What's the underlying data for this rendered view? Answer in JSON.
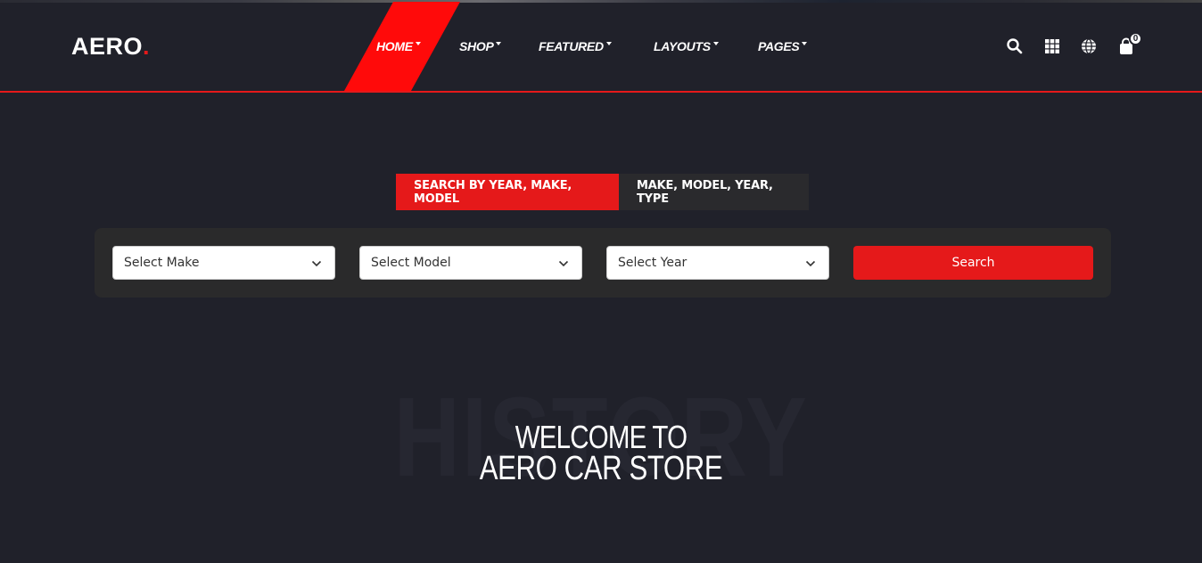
{
  "brand": {
    "name": "AERO",
    "dot": ".",
    "accent_color": "#e5191a"
  },
  "nav": {
    "items": [
      {
        "label": "HOME",
        "active": true
      },
      {
        "label": "SHOP",
        "active": false
      },
      {
        "label": "FEATURED",
        "active": false
      },
      {
        "label": "LAYOUTS",
        "active": false
      },
      {
        "label": "PAGES",
        "active": false
      }
    ]
  },
  "header_icons": {
    "search": "search-icon",
    "grid": "grid-icon",
    "language": "globe-icon",
    "cart": "shopping-bag-icon",
    "cart_count": "0"
  },
  "search": {
    "tabs": [
      {
        "label": "SEARCH BY YEAR, MAKE, MODEL",
        "active": true
      },
      {
        "label": "MAKE, MODEL, YEAR, TYPE",
        "active": false
      }
    ],
    "selects": {
      "make": "Select Make",
      "model": "Select Model",
      "year": "Select Year"
    },
    "button_label": "Search"
  },
  "hero": {
    "background_word": "HISTORY",
    "line1": "WELCOME TO",
    "line2": "AERO CAR STORE"
  }
}
